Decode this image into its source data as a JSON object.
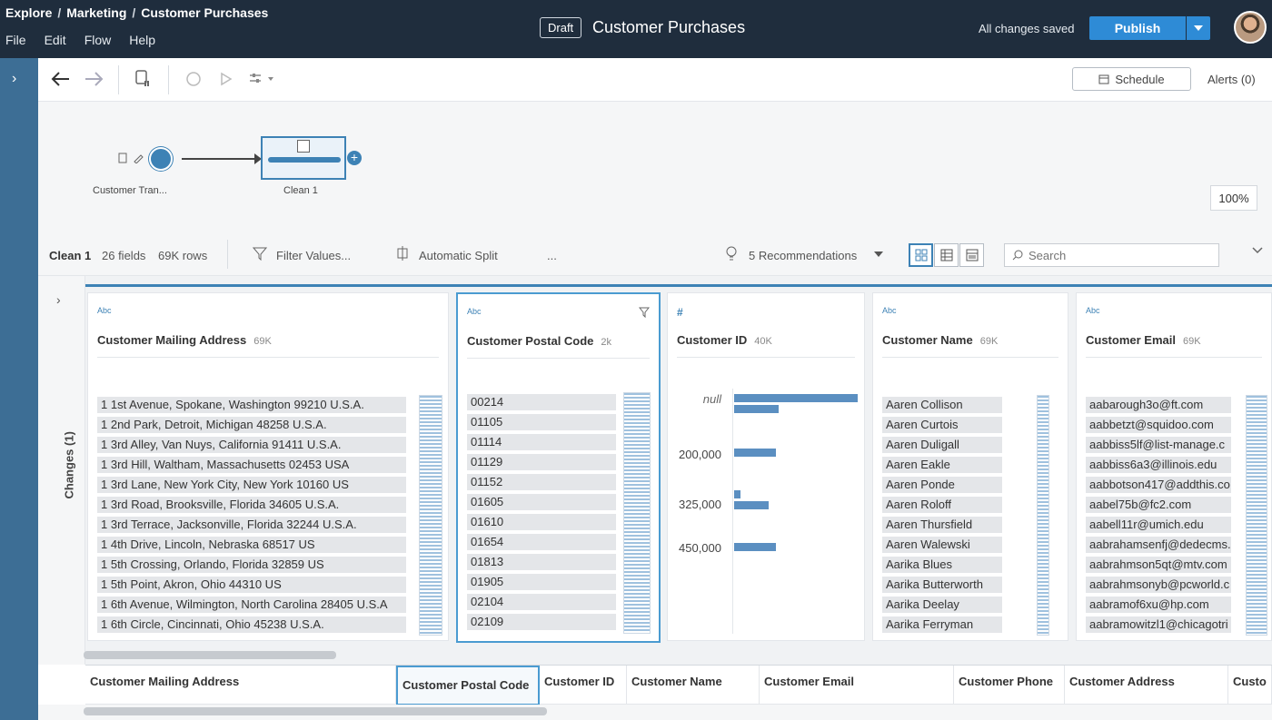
{
  "header": {
    "breadcrumb": [
      "Explore",
      "Marketing",
      "Customer Purchases"
    ],
    "breadcrumb_sep": "/",
    "menu": [
      "File",
      "Edit",
      "Flow",
      "Help"
    ],
    "draft_label": "Draft",
    "title": "Customer Purchases",
    "save_status": "All changes saved",
    "publish_label": "Publish"
  },
  "toolbar": {
    "schedule_label": "Schedule",
    "alerts_label": "Alerts (0)"
  },
  "flow": {
    "input_label": "Customer Tran...",
    "clean_label": "Clean 1",
    "zoom": "100%"
  },
  "cleanbar": {
    "step_name": "Clean 1",
    "fields": "26 fields",
    "rows": "69K rows",
    "filter_label": "Filter Values...",
    "split_label": "Automatic Split",
    "more": "...",
    "recommendations": "5 Recommendations",
    "search_placeholder": "Search"
  },
  "changes_label": "Changes (1)",
  "cards": {
    "mailing": {
      "type": "Abc",
      "name": "Customer Mailing Address",
      "count": "69K",
      "values": [
        "1 1st Avenue, Spokane, Washington 99210 U.S.A.",
        "1 2nd Park, Detroit, Michigan 48258 U.S.A.",
        "1 3rd Alley, Van Nuys, California 91411 U.S.A.",
        "1 3rd Hill, Waltham, Massachusetts 02453 USA",
        "1 3rd Lane, New York City, New York 10160 US",
        "1 3rd Road, Brooksville, Florida 34605 U.S.A.",
        "1 3rd Terrace, Jacksonville, Florida 32244 U.S.A.",
        "1 4th Drive, Lincoln, Nebraska 68517 US",
        "1 5th Crossing, Orlando, Florida 32859 US",
        "1 5th Point, Akron, Ohio 44310 US",
        "1 6th Avenue, Wilmington, North Carolina 28405 U.S.A",
        "1 6th Circle, Cincinnati, Ohio 45238 U.S.A."
      ]
    },
    "postal": {
      "type": "Abc",
      "name": "Customer Postal Code",
      "count": "2k",
      "values": [
        "00214",
        "01105",
        "01114",
        "01129",
        "01152",
        "01605",
        "01610",
        "01654",
        "01813",
        "01905",
        "02104",
        "02109"
      ]
    },
    "customer_id": {
      "type": "#",
      "name": "Customer ID",
      "count": "40K"
    },
    "name": {
      "type": "Abc",
      "name": "Customer Name",
      "count": "69K",
      "values": [
        "Aaren Collison",
        "Aaren Curtois",
        "Aaren Duligall",
        "Aaren Eakle",
        "Aaren Ponde",
        "Aaren Roloff",
        "Aaren Thursfield",
        "Aaren Walewski",
        "Aarika Blues",
        "Aarika Butterworth",
        "Aarika Deelay",
        "Aarika Ferryman"
      ]
    },
    "email": {
      "type": "Abc",
      "name": "Customer Email",
      "count": "69K",
      "values": [
        "aabarough3o@ft.com",
        "aabbetzt@squidoo.com",
        "aabbiss5lf@list-manage.c",
        "aabbiss6a3@illinois.edu",
        "aabbotson417@addthis.co",
        "aabel75b@fc2.com",
        "aabell11r@umich.edu",
        "aabrahamsenfj@dedecms.",
        "aabrahmson5qt@mtv.com",
        "aabrahmsonyb@pcworld.c",
        "aabramof6xu@hp.com",
        "aabramowitzl1@chicagotri"
      ]
    }
  },
  "chart_data": {
    "type": "bar",
    "title": "",
    "categories": [
      "null",
      "200,000",
      "325,000",
      "450,000"
    ],
    "series": [
      {
        "values": [
          1.0,
          0.36
        ]
      },
      {
        "values": [
          0.34
        ]
      },
      {
        "values": [
          0.05,
          0.28
        ]
      },
      {
        "values": [
          0.34
        ]
      }
    ]
  },
  "grid_headers": [
    "Customer Mailing Address",
    "Customer Postal Code",
    "Customer ID",
    "Customer Name",
    "Customer Email",
    "Customer Phone",
    "Customer Address",
    "Custo"
  ],
  "colors": {
    "header_bg": "#1f2d3d",
    "rail": "#3d6e95",
    "accent": "#2e8bd6",
    "bar": "#5b8fc1"
  }
}
